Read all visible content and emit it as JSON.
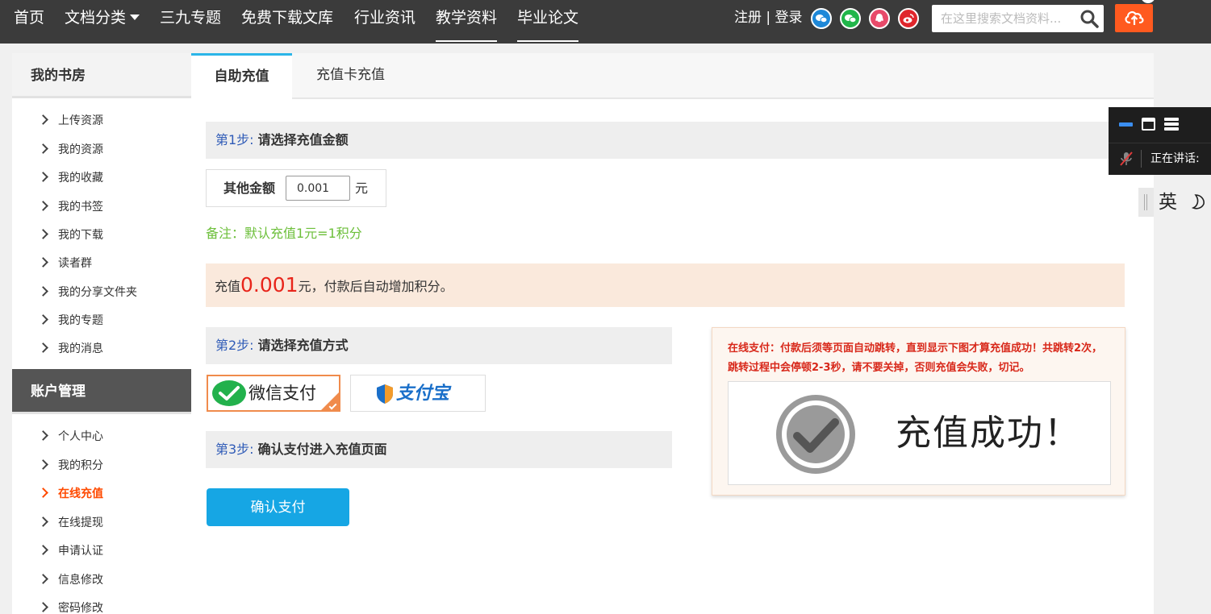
{
  "nav": {
    "items": [
      "首页",
      "文档分类",
      "三九专题",
      "免费下载文库",
      "行业资讯",
      "教学资料",
      "毕业论文"
    ],
    "register": "注册",
    "separator": "|",
    "login": "登录",
    "search_placeholder": "在这里搜索文档资料..."
  },
  "sidebar": {
    "section1_title": "我的书房",
    "section1_items": [
      "上传资源",
      "我的资源",
      "我的收藏",
      "我的书签",
      "我的下载",
      "读者群",
      "我的分享文件夹",
      "我的专题",
      "我的消息"
    ],
    "section2_title": "账户管理",
    "section2_items": [
      "个人中心",
      "我的积分",
      "在线充值",
      "在线提现",
      "申请认证",
      "信息修改",
      "密码修改"
    ]
  },
  "tabs": [
    "自助充值",
    "充值卡充值"
  ],
  "step1": {
    "no": "第1步:",
    "text": "请选择充值金额"
  },
  "amount": {
    "label": "其他金额",
    "value": "0.001",
    "unit": "元"
  },
  "note": "备注：默认充值1元=1积分",
  "summary": {
    "prefix": "充值",
    "amount": "0.001",
    "suffix": "元，付款后自动增加积分。"
  },
  "step2": {
    "no": "第2步:",
    "text": "请选择充值方式"
  },
  "payment": {
    "wechat": "微信支付",
    "alipay": "支付宝"
  },
  "step3": {
    "no": "第3步:",
    "text": "确认支付进入充值页面"
  },
  "confirm_button": "确认支付",
  "notice": {
    "text": "在线支付：付款后须等页面自动跳转，直到显示下图才算充值成功！共跳转2次，跳转过程中会停顿2-3秒，请不要关掉，否则充值会失败，切记。",
    "success": "充值成功！"
  },
  "voice": {
    "status": "正在讲话:"
  },
  "ime": {
    "lang": "英"
  },
  "colors": {
    "accent": "#16a6e4",
    "active": "#ff4a00",
    "danger": "#e8251b",
    "note": "#6cbf3a"
  }
}
